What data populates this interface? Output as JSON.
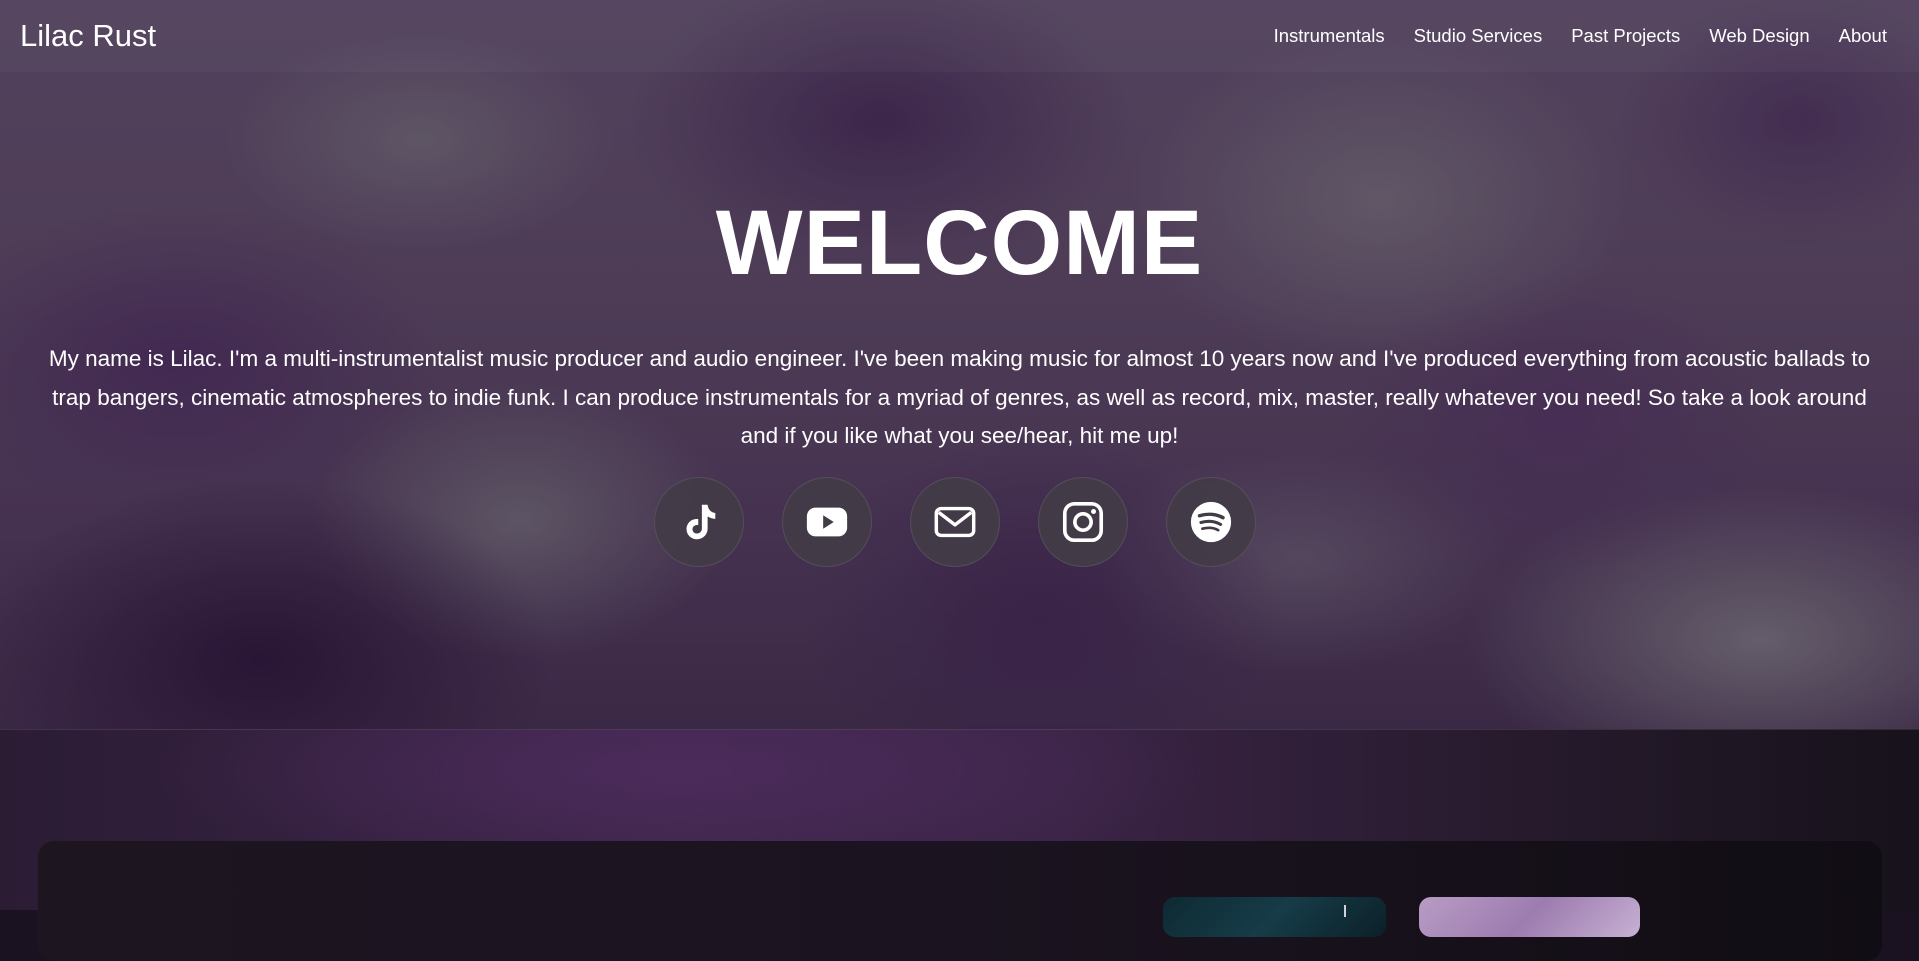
{
  "site": {
    "brand": "Lilac Rust"
  },
  "nav": {
    "items": [
      {
        "label": "Instrumentals"
      },
      {
        "label": "Studio Services"
      },
      {
        "label": "Past Projects"
      },
      {
        "label": "Web Design"
      },
      {
        "label": "About"
      }
    ]
  },
  "hero": {
    "title": "WELCOME",
    "intro": "My name is Lilac. I'm a multi-instrumentalist music producer and audio engineer. I've been making music for almost 10 years now and I've produced everything from acoustic ballads to trap bangers, cinematic atmospheres to indie funk. I can produce instrumentals for a myriad of genres, as well as record, mix, master, really whatever you need! So take a look around and if you like what you see/hear, hit me up!"
  },
  "socials": [
    {
      "icon": "tiktok-icon"
    },
    {
      "icon": "youtube-icon"
    },
    {
      "icon": "email-icon"
    },
    {
      "icon": "instagram-icon"
    },
    {
      "icon": "spotify-icon"
    }
  ],
  "colors": {
    "text": "#ffffff",
    "social_bg": "#423c46",
    "panel_bg": "#1b1420"
  }
}
